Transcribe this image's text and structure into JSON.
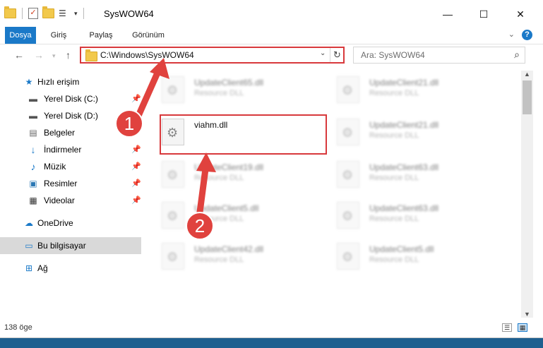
{
  "window": {
    "title": "SysWOW64",
    "minimize": "—",
    "maximize": "☐",
    "close": "✕"
  },
  "ribbon": {
    "tabs": [
      {
        "label": "Dosya"
      },
      {
        "label": "Giriş"
      },
      {
        "label": "Paylaş"
      },
      {
        "label": "Görünüm"
      }
    ],
    "help": "?"
  },
  "address_bar": {
    "path": "C:\\Windows\\SysWOW64"
  },
  "search": {
    "placeholder": "Ara: SysWOW64"
  },
  "nav_pane": {
    "quick_access": "Hızlı erişim",
    "items": [
      {
        "label": "Yerel Disk (C:)"
      },
      {
        "label": "Yerel Disk (D:)"
      },
      {
        "label": "Belgeler"
      },
      {
        "label": "İndirmeler"
      },
      {
        "label": "Müzik"
      },
      {
        "label": "Resimler"
      },
      {
        "label": "Videolar"
      }
    ],
    "onedrive": "OneDrive",
    "this_pc": "Bu bilgisayar",
    "network": "Ağ"
  },
  "files": {
    "left": [
      {
        "name": "UpdateClient65.dll",
        "type": "Resource DLL"
      },
      {
        "name": "viahm.dll",
        "type": ""
      },
      {
        "name": "UpdateClient19.dll",
        "type": "Resource DLL"
      },
      {
        "name": "UpdateClient5.dll",
        "type": "Resource DLL"
      },
      {
        "name": "UpdateClient42.dll",
        "type": "Resource DLL"
      }
    ],
    "right": [
      {
        "name": "UpdateClient21.dll",
        "type": "Resource DLL"
      },
      {
        "name": "UpdateClient21.dll",
        "type": "Resource DLL"
      },
      {
        "name": "UpdateClient63.dll",
        "type": "Resource DLL"
      },
      {
        "name": "UpdateClient63.dll",
        "type": "Resource DLL"
      },
      {
        "name": "UpdateClient5.dll",
        "type": "Resource DLL"
      }
    ]
  },
  "status_bar": {
    "item_count": "138 öge"
  },
  "annotations": {
    "step1": "1",
    "step2": "2",
    "color": "#e0423e"
  }
}
